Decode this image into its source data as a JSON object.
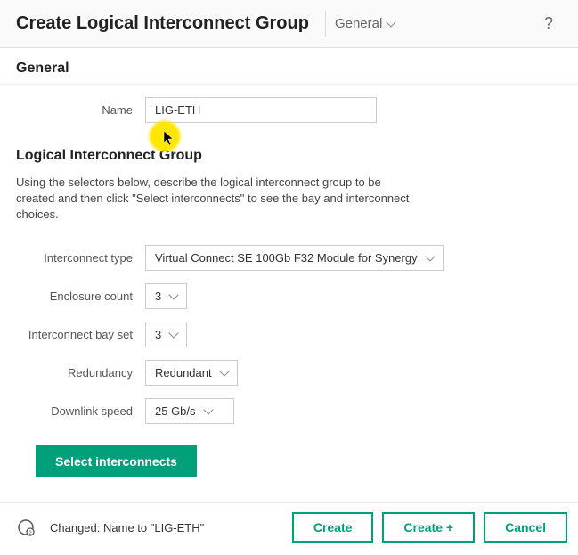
{
  "header": {
    "title": "Create Logical Interconnect Group",
    "dropdown_label": "General",
    "help_icon": "?"
  },
  "general": {
    "section_title": "General",
    "name_label": "Name",
    "name_value": "LIG-ETH"
  },
  "lig": {
    "section_title": "Logical Interconnect Group",
    "description": "Using the selectors below, describe the logical interconnect group to be created and then click \"Select interconnects\" to see the bay and interconnect choices.",
    "fields": {
      "interconnect_type_label": "Interconnect type",
      "interconnect_type_value": "Virtual Connect SE 100Gb F32 Module for Synergy",
      "enclosure_count_label": "Enclosure count",
      "enclosure_count_value": "3",
      "bay_set_label": "Interconnect bay set",
      "bay_set_value": "3",
      "redundancy_label": "Redundancy",
      "redundancy_value": "Redundant",
      "downlink_speed_label": "Downlink speed",
      "downlink_speed_value": "25 Gb/s"
    },
    "select_btn": "Select interconnects"
  },
  "footer": {
    "message": "Changed: Name to \"LIG-ETH\"",
    "create_btn": "Create",
    "create_plus_btn": "Create +",
    "cancel_btn": "Cancel"
  }
}
